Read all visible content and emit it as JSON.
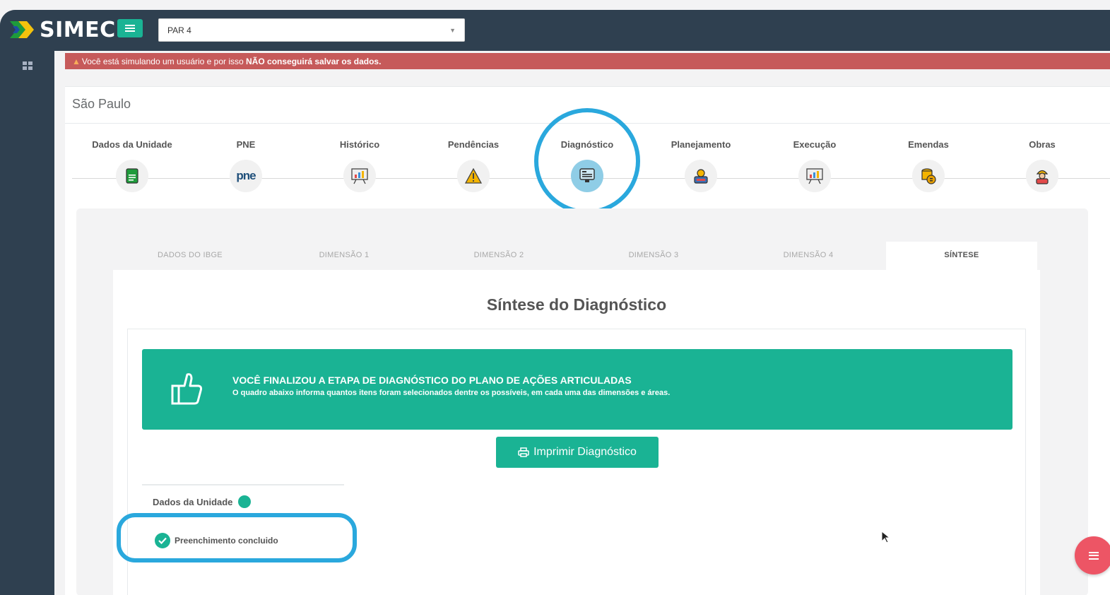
{
  "app": {
    "logo_text": "SIMEC",
    "program_select_value": "PAR 4"
  },
  "warning": {
    "prefix": "Você está simulando um usuário e por isso ",
    "bold": "NÃO conseguirá salvar os dados."
  },
  "unit": {
    "name": "São Paulo"
  },
  "steps": [
    {
      "label": "Dados da Unidade",
      "icon": "document-icon"
    },
    {
      "label": "PNE",
      "icon": "pne-logo-icon"
    },
    {
      "label": "Histórico",
      "icon": "presentation-chart-icon"
    },
    {
      "label": "Pendências",
      "icon": "warning-icon"
    },
    {
      "label": "Diagnóstico",
      "icon": "monitor-icon",
      "active": true
    },
    {
      "label": "Planejamento",
      "icon": "planning-icon"
    },
    {
      "label": "Execução",
      "icon": "presentation-chart-icon"
    },
    {
      "label": "Emendas",
      "icon": "coins-icon"
    },
    {
      "label": "Obras",
      "icon": "worker-icon"
    }
  ],
  "tabs": [
    {
      "label": "DADOS DO IBGE"
    },
    {
      "label": "DIMENSÃO 1"
    },
    {
      "label": "DIMENSÃO 2"
    },
    {
      "label": "DIMENSÃO 3"
    },
    {
      "label": "DIMENSÃO 4"
    },
    {
      "label": "SÍNTESE",
      "active": true
    }
  ],
  "synthesis": {
    "title": "Síntese do Diagnóstico",
    "banner_title": "VOCÊ FINALIZOU A ETAPA DE DIAGNÓSTICO DO PLANO DE AÇÕES ARTICULADAS",
    "banner_subtitle": "O quadro abaixo informa quantos itens foram selecionados dentre os possíveis, em cada uma das dimensões e áreas.",
    "print_button": "Imprimir Diagnóstico",
    "section_label": "Dados da Unidade",
    "status_text": "Preenchimento concluido"
  },
  "colors": {
    "accent": "#1ab394",
    "sidebar": "#2f4050",
    "warning": "#c65a5a",
    "highlight": "#2aa8dd",
    "fab": "#ed5565"
  }
}
